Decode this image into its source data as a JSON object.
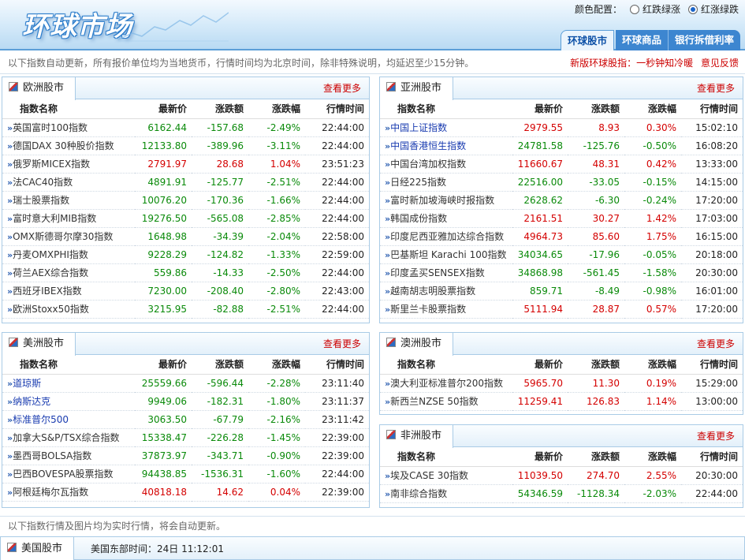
{
  "logo": {
    "text": "环球市场"
  },
  "color_config": {
    "label": "颜色配置：",
    "options": [
      "红跌绿涨",
      "红涨绿跌"
    ],
    "selected": 1
  },
  "nav": {
    "tabs": [
      "环球股市",
      "环球商品",
      "银行拆借利率"
    ],
    "active": 0
  },
  "notice": {
    "left": "以下指数自动更新，所有报价单位均为当地货币，行情时间均为北京时间，除非特殊说明，均延迟至少15分钟。",
    "right_text": "新版环球股指：一秒钟知冷暖",
    "right_link": "意见反馈"
  },
  "columns": [
    "指数名称",
    "最新价",
    "涨跌额",
    "涨跌幅",
    "行情时间"
  ],
  "more_label": "查看更多",
  "colors": {
    "up": "#d40000",
    "down": "#0a8a0a",
    "link": "#1a3cb0"
  },
  "panels": {
    "europe": {
      "title": "欧洲股市",
      "rows": [
        {
          "name": "英国富时100指数",
          "price": "6162.44",
          "chg": "-157.68",
          "pct": "-2.49%",
          "time": "22:44:00",
          "dir": "dn"
        },
        {
          "name": "德国DAX 30种股价指数",
          "price": "12133.80",
          "chg": "-389.96",
          "pct": "-3.11%",
          "time": "22:44:00",
          "dir": "dn"
        },
        {
          "name": "俄罗斯MICEX指数",
          "price": "2791.97",
          "chg": "28.68",
          "pct": "1.04%",
          "time": "23:51:23",
          "dir": "up"
        },
        {
          "name": "法CAC40指数",
          "price": "4891.91",
          "chg": "-125.77",
          "pct": "-2.51%",
          "time": "22:44:00",
          "dir": "dn"
        },
        {
          "name": "瑞士股票指数",
          "price": "10076.20",
          "chg": "-170.36",
          "pct": "-1.66%",
          "time": "22:44:00",
          "dir": "dn"
        },
        {
          "name": "富时意大利MIB指数",
          "price": "19276.50",
          "chg": "-565.08",
          "pct": "-2.85%",
          "time": "22:44:00",
          "dir": "dn"
        },
        {
          "name": "OMX斯德哥尔摩30指数",
          "price": "1648.98",
          "chg": "-34.39",
          "pct": "-2.04%",
          "time": "22:58:00",
          "dir": "dn"
        },
        {
          "name": "丹麦OMXPHI指数",
          "price": "9228.29",
          "chg": "-124.82",
          "pct": "-1.33%",
          "time": "22:59:00",
          "dir": "dn"
        },
        {
          "name": "荷兰AEX综合指数",
          "price": "559.86",
          "chg": "-14.33",
          "pct": "-2.50%",
          "time": "22:44:00",
          "dir": "dn"
        },
        {
          "name": "西班牙IBEX指数",
          "price": "7230.00",
          "chg": "-208.40",
          "pct": "-2.80%",
          "time": "22:43:00",
          "dir": "dn"
        },
        {
          "name": "欧洲Stoxx50指数",
          "price": "3215.95",
          "chg": "-82.88",
          "pct": "-2.51%",
          "time": "22:44:00",
          "dir": "dn"
        }
      ]
    },
    "asia": {
      "title": "亚洲股市",
      "rows": [
        {
          "name": "中国上证指数",
          "price": "2979.55",
          "chg": "8.93",
          "pct": "0.30%",
          "time": "15:02:10",
          "dir": "up",
          "link": true
        },
        {
          "name": "中国香港恒生指数",
          "price": "24781.58",
          "chg": "-125.76",
          "pct": "-0.50%",
          "time": "16:08:20",
          "dir": "dn",
          "link": true
        },
        {
          "name": "中国台湾加权指数",
          "price": "11660.67",
          "chg": "48.31",
          "pct": "0.42%",
          "time": "13:33:00",
          "dir": "up"
        },
        {
          "name": "日经225指数",
          "price": "22516.00",
          "chg": "-33.05",
          "pct": "-0.15%",
          "time": "14:15:00",
          "dir": "dn"
        },
        {
          "name": "富时新加坡海峡时报指数",
          "price": "2628.62",
          "chg": "-6.30",
          "pct": "-0.24%",
          "time": "17:20:00",
          "dir": "dn"
        },
        {
          "name": "韩国成份指数",
          "price": "2161.51",
          "chg": "30.27",
          "pct": "1.42%",
          "time": "17:03:00",
          "dir": "up"
        },
        {
          "name": "印度尼西亚雅加达综合指数",
          "price": "4964.73",
          "chg": "85.60",
          "pct": "1.75%",
          "time": "16:15:00",
          "dir": "up"
        },
        {
          "name": "巴基斯坦 Karachi 100指数",
          "price": "34034.65",
          "chg": "-17.96",
          "pct": "-0.05%",
          "time": "20:18:00",
          "dir": "dn"
        },
        {
          "name": "印度孟买SENSEX指数",
          "price": "34868.98",
          "chg": "-561.45",
          "pct": "-1.58%",
          "time": "20:30:00",
          "dir": "dn"
        },
        {
          "name": "越南胡志明股票指数",
          "price": "859.71",
          "chg": "-8.49",
          "pct": "-0.98%",
          "time": "16:01:00",
          "dir": "dn"
        },
        {
          "name": "斯里兰卡股票指数",
          "price": "5111.94",
          "chg": "28.87",
          "pct": "0.57%",
          "time": "17:20:00",
          "dir": "up"
        }
      ]
    },
    "america": {
      "title": "美洲股市",
      "rows": [
        {
          "name": "道琼斯",
          "price": "25559.66",
          "chg": "-596.44",
          "pct": "-2.28%",
          "time": "23:11:40",
          "dir": "dn",
          "link": true
        },
        {
          "name": "纳斯达克",
          "price": "9949.06",
          "chg": "-182.31",
          "pct": "-1.80%",
          "time": "23:11:37",
          "dir": "dn",
          "link": true
        },
        {
          "name": "标准普尔500",
          "price": "3063.50",
          "chg": "-67.79",
          "pct": "-2.16%",
          "time": "23:11:42",
          "dir": "dn",
          "link": true
        },
        {
          "name": "加拿大S&P/TSX综合指数",
          "price": "15338.47",
          "chg": "-226.28",
          "pct": "-1.45%",
          "time": "22:39:00",
          "dir": "dn"
        },
        {
          "name": "墨西哥BOLSA指数",
          "price": "37873.97",
          "chg": "-343.71",
          "pct": "-0.90%",
          "time": "22:39:00",
          "dir": "dn"
        },
        {
          "name": "巴西BOVESPA股票指数",
          "price": "94438.85",
          "chg": "-1536.31",
          "pct": "-1.60%",
          "time": "22:44:00",
          "dir": "dn"
        },
        {
          "name": "阿根廷梅尔瓦指数",
          "price": "40818.18",
          "chg": "14.62",
          "pct": "0.04%",
          "time": "22:39:00",
          "dir": "up"
        }
      ]
    },
    "australia": {
      "title": "澳洲股市",
      "rows": [
        {
          "name": "澳大利亚标准普尔200指数",
          "price": "5965.70",
          "chg": "11.30",
          "pct": "0.19%",
          "time": "15:29:00",
          "dir": "up"
        },
        {
          "name": "新西兰NZSE 50指数",
          "price": "11259.41",
          "chg": "126.83",
          "pct": "1.14%",
          "time": "13:00:00",
          "dir": "up"
        }
      ]
    },
    "africa": {
      "title": "非洲股市",
      "rows": [
        {
          "name": "埃及CASE 30指数",
          "price": "11039.50",
          "chg": "274.70",
          "pct": "2.55%",
          "time": "20:30:00",
          "dir": "up"
        },
        {
          "name": "南非综合指数",
          "price": "54346.59",
          "chg": "-1128.34",
          "pct": "-2.03%",
          "time": "22:44:00",
          "dir": "dn"
        }
      ]
    }
  },
  "footer_note": "以下指数行情及图片均为实时行情，将会自动更新。",
  "us_strip": {
    "title": "美国股市",
    "time_label": "美国东部时间：24日 11:12:01"
  }
}
